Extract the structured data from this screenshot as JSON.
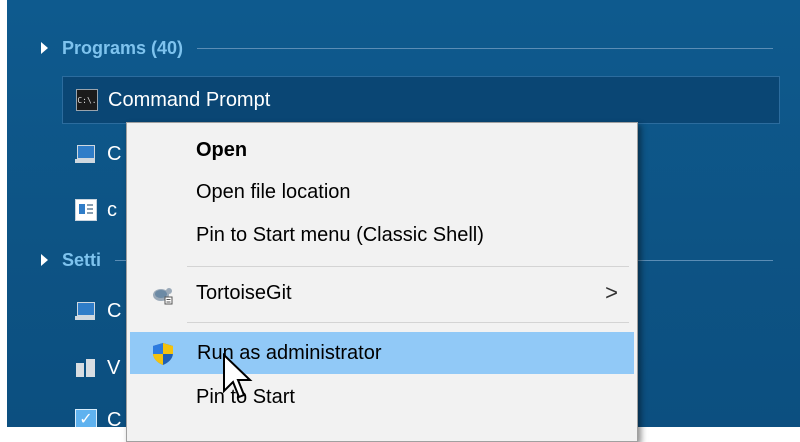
{
  "groups": {
    "programs_title": "Programs (40)",
    "settings_title": "Setti"
  },
  "rows": {
    "command_prompt": "Command Prompt",
    "row2_partial": "C",
    "row3_partial": "c",
    "row5_partial": "C",
    "row6_partial": "V",
    "row7_partial": "C"
  },
  "cmd_icon_text": "C:\\.",
  "context_menu": {
    "open": "Open",
    "open_file_location": "Open file location",
    "pin_classic": "Pin to Start menu (Classic Shell)",
    "tortoisegit": "TortoiseGit",
    "tortoisegit_arrow": ">",
    "run_as_admin": "Run as administrator",
    "pin_to_start": "Pin to Start"
  },
  "colors": {
    "panel_bg": "#0e5a8e",
    "group_title": "#7ec3ee",
    "menu_bg": "#f2f2f2",
    "highlight": "#91c9f7"
  }
}
